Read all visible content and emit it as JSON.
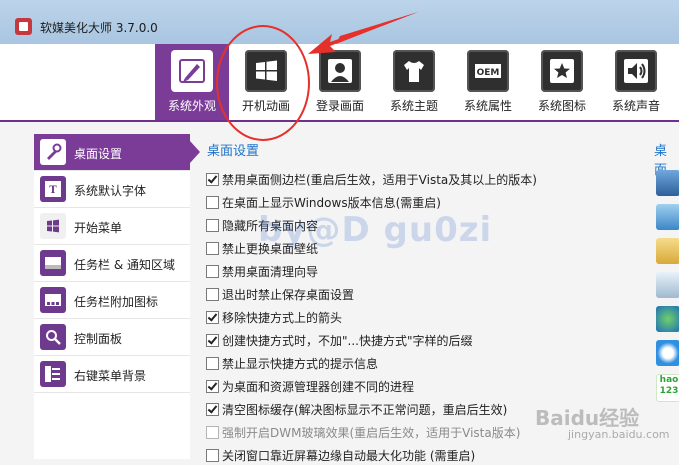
{
  "window": {
    "title": "软媒美化大师 3.7.0.0"
  },
  "toolbar": {
    "tabs": [
      {
        "label": "系统外观",
        "icon": "paint-brush-icon",
        "active": true
      },
      {
        "label": "开机动画",
        "icon": "windows-logo-icon",
        "active": false
      },
      {
        "label": "登录画面",
        "icon": "user-silhouette-icon",
        "active": false
      },
      {
        "label": "系统主题",
        "icon": "tshirt-icon",
        "active": false
      },
      {
        "label": "系统属性",
        "icon": "oem-icon",
        "oem_text": "OEM",
        "active": false
      },
      {
        "label": "系统图标",
        "icon": "star-icon",
        "active": false
      },
      {
        "label": "系统声音",
        "icon": "speaker-icon",
        "active": false
      }
    ]
  },
  "sidebar": {
    "items": [
      {
        "label": "桌面设置",
        "icon": "wrench-icon",
        "active": true
      },
      {
        "label": "系统默认字体",
        "icon": "font-icon",
        "active": false
      },
      {
        "label": "开始菜单",
        "icon": "start-orb-icon",
        "active": false
      },
      {
        "label": "任务栏 & 通知区域",
        "icon": "taskbar-icon",
        "active": false
      },
      {
        "label": "任务栏附加图标",
        "icon": "taskbar-icons-icon",
        "active": false
      },
      {
        "label": "控制面板",
        "icon": "magnifier-icon",
        "active": false
      },
      {
        "label": "右键菜单背景",
        "icon": "context-menu-icon",
        "active": false
      }
    ]
  },
  "content": {
    "section_title": "桌面设置",
    "options": [
      {
        "label": "禁用桌面侧边栏(重启后生效，适用于Vista及其以上的版本)",
        "checked": true,
        "enabled": true
      },
      {
        "label": "在桌面上显示Windows版本信息(需重启)",
        "checked": false,
        "enabled": true
      },
      {
        "label": "隐藏所有桌面内容",
        "checked": false,
        "enabled": true
      },
      {
        "label": "禁止更换桌面壁纸",
        "checked": false,
        "enabled": true
      },
      {
        "label": "禁用桌面清理向导",
        "checked": false,
        "enabled": true
      },
      {
        "label": "退出时禁止保存桌面设置",
        "checked": false,
        "enabled": true
      },
      {
        "label": "移除快捷方式上的箭头",
        "checked": true,
        "enabled": true
      },
      {
        "label": "创建快捷方式时，不加\"...快捷方式\"字样的后缀",
        "checked": true,
        "enabled": true
      },
      {
        "label": "禁止显示快捷方式的提示信息",
        "checked": false,
        "enabled": true
      },
      {
        "label": "为桌面和资源管理器创建不同的进程",
        "checked": true,
        "enabled": true
      },
      {
        "label": "清空图标缓存(解决图标显示不正常问题，重启后生效)",
        "checked": true,
        "enabled": true
      },
      {
        "label": "强制开启DWM玻璃效果(重启后生效，适用于Vista版本)",
        "checked": false,
        "enabled": false
      },
      {
        "label": "关闭窗口靠近屏幕边缘自动最大化功能 (需重启)",
        "checked": false,
        "enabled": true
      }
    ],
    "watermark": "by@D gu0zi"
  },
  "right_panel": {
    "title": "桌面",
    "icons": [
      "computer-icon",
      "network-icon",
      "folder-icon",
      "recycle-bin-icon",
      "globe-icon",
      "ie-icon",
      "hao123-icon"
    ],
    "hao123_text": "hao\n123"
  },
  "watermarks": {
    "baidu": "Baidu经验",
    "baidu_url": "jingyan.baidu.com"
  },
  "colors": {
    "accent": "#7b3c98",
    "link": "#1f73c8",
    "annotation": "#e5302b"
  }
}
